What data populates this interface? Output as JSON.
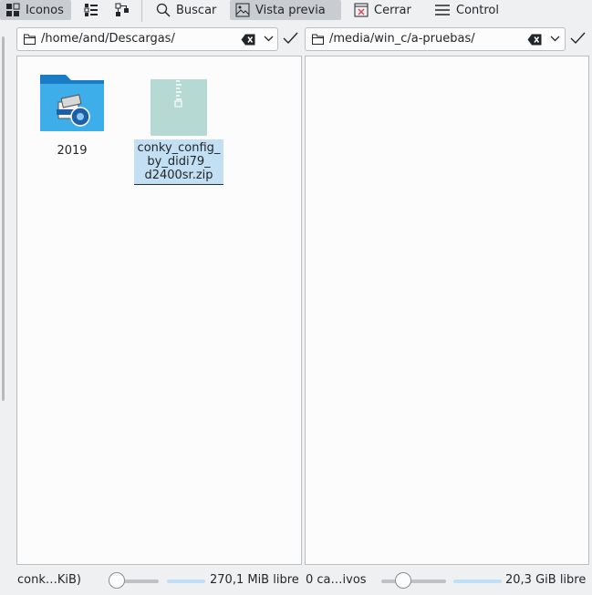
{
  "toolbar": {
    "icons_label": "Iconos",
    "search_label": "Buscar",
    "preview_label": "Vista previa",
    "close_label": "Cerrar",
    "control_label": "Control"
  },
  "left_pane": {
    "path": "/home/and/Descargas/",
    "files": [
      {
        "name": "2019",
        "type": "folder"
      },
      {
        "name_lines": [
          "conky_config_",
          "by_didi79_",
          "d2400sr.zip"
        ],
        "type": "zip",
        "selected": true
      }
    ],
    "status_text": "conk…KiB)",
    "free_space": "270,1 MiB libre"
  },
  "right_pane": {
    "path": "/media/win_c/a-pruebas/",
    "files": [],
    "status_text": "0 ca…ivos",
    "free_space": "20,3 GiB libre"
  },
  "colors": {
    "background": "#eff0f1",
    "selection": "#c2dff4",
    "folder_blue": "#1d99f3",
    "zip_tile": "#b6d9d3"
  },
  "icons": [
    "icons-view-icon",
    "details-view-icon",
    "tree-view-icon",
    "search-icon",
    "image-preview-icon",
    "close-document-icon",
    "hamburger-menu-icon",
    "folder-icon",
    "clear-text-icon",
    "chevron-down-icon",
    "checkmark-icon"
  ]
}
